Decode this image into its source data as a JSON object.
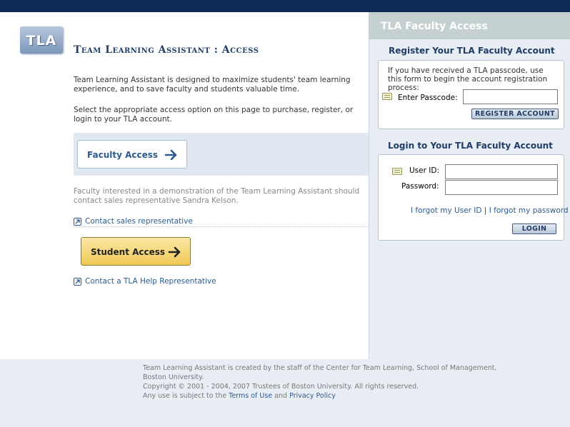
{
  "header": {
    "logo_text": "TLA",
    "page_title": "Team Learning Assistant : Access"
  },
  "intro": {
    "paragraph1": "Team Learning Assistant is designed to maximize students' team learning experience, and to save faculty and students valuable time.",
    "paragraph2": "Select the appropriate access option on this page to purchase, register, or login to your TLA account."
  },
  "faculty_access": {
    "label": "Faculty Access",
    "icon": "arrow-right-icon"
  },
  "demo_note": "Faculty interested in a demonstration of the Team Learning Assistant should contact sales representative Sandra Kelson.",
  "links": {
    "contact_sales": "Contact sales representative",
    "contact_help": "Contact a TLA Help Representative"
  },
  "student_access": {
    "label": "Student Access",
    "icon": "arrow-right-icon"
  },
  "sidebar": {
    "header": "TLA Faculty Access",
    "register": {
      "title": "Register Your TLA Faculty Account",
      "description": "If you have received a TLA passcode, use this form to begin the account registration process:",
      "passcode_label": "Enter Passcode:",
      "passcode_value": "",
      "button": "REGISTER ACCOUNT"
    },
    "login": {
      "title": "Login to Your TLA Faculty Account",
      "userid_label": "User ID:",
      "userid_value": "",
      "password_label": "Password:",
      "password_value": "",
      "forgot_userid": "I forgot my User ID",
      "separator": "|",
      "forgot_password": "I forgot my password",
      "button": "LOGIN"
    }
  },
  "footer": {
    "line1": "Team Learning Assistant is created by the staff of the Center for Team Learning, School of Management, Boston University.",
    "line2": "Copyright © 2001 - 2004, 2007 Trustees of Boston University. All rights reserved.",
    "line3_prefix": "Any use is subject to the",
    "terms_link": "Terms of Use",
    "and_text": "and",
    "privacy_link": "Privacy Policy"
  },
  "colors": {
    "top_bar": "#0c2b57",
    "accent": "#2d5b8f",
    "student_button": "#f1c955",
    "sidebar_bg": "#e9edf4"
  }
}
